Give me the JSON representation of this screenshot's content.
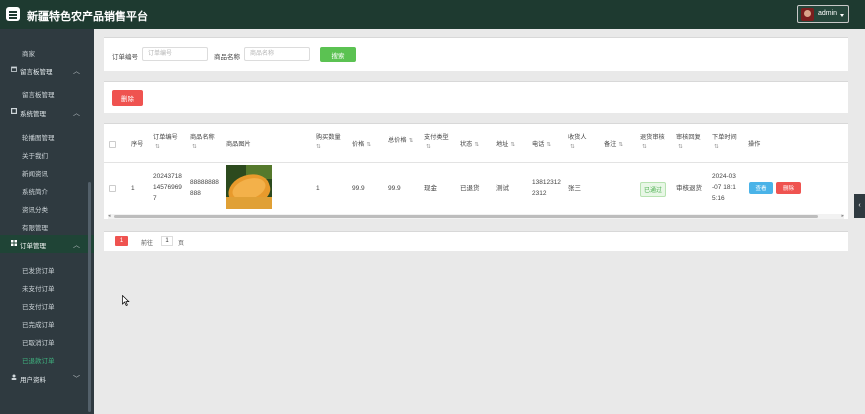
{
  "header": {
    "title": "新疆特色农产品销售平台",
    "user": "admin"
  },
  "sidebar": {
    "items": [
      {
        "label": "商家",
        "type": "sub"
      },
      {
        "label": "留言板管理",
        "type": "group",
        "icon": "calendar-icon"
      },
      {
        "label": "留言板管理",
        "type": "sub"
      },
      {
        "label": "系统管理",
        "type": "group",
        "icon": "grid-icon"
      },
      {
        "label": "轮播图管理",
        "type": "sub"
      },
      {
        "label": "关于我们",
        "type": "sub"
      },
      {
        "label": "新闻资讯",
        "type": "sub"
      },
      {
        "label": "系统简介",
        "type": "sub"
      },
      {
        "label": "资讯分类",
        "type": "sub"
      },
      {
        "label": "有限管理",
        "type": "sub"
      },
      {
        "label": "订单管理",
        "type": "group-active",
        "icon": "apps-icon"
      },
      {
        "label": "已发货订单",
        "type": "sub"
      },
      {
        "label": "未支付订单",
        "type": "sub"
      },
      {
        "label": "已支付订单",
        "type": "sub"
      },
      {
        "label": "已完成订单",
        "type": "sub"
      },
      {
        "label": "已取消订单",
        "type": "sub"
      },
      {
        "label": "已退款订单",
        "type": "sub-current"
      },
      {
        "label": "用户资料",
        "type": "group",
        "icon": "user-icon"
      }
    ]
  },
  "search": {
    "order_label": "订单编号",
    "order_placeholder": "订单编号",
    "product_label": "商品名称",
    "product_placeholder": "商品名称",
    "button": "搜索"
  },
  "actions": {
    "delete": "删除"
  },
  "table": {
    "columns": [
      "序号",
      "订单编号",
      "商品名称",
      "商品图片",
      "购买数量",
      "价格",
      "总价格",
      "支付类型",
      "状态",
      "地址",
      "电话",
      "收货人",
      "备注",
      "退货审核",
      "审核回复",
      "下单时间",
      "操作"
    ],
    "row": {
      "index": "1",
      "order_no": "20243718145769 7",
      "order_no_lines": [
        "20243718",
        "14576969",
        "7"
      ],
      "product_lines": [
        "88888888",
        "888"
      ],
      "image_icon": "melon-image",
      "qty": "1",
      "price": "99.9",
      "total": "99.9",
      "pay_type": "现金",
      "status": "已退货",
      "address": "测试",
      "phone_lines": [
        "13812312",
        "2312"
      ],
      "receiver": "张三",
      "note": "",
      "audit": "已通过",
      "reply": "审核退货",
      "time_lines": [
        "2024-03",
        "-07 18:1",
        "5:16"
      ],
      "view": "查看",
      "delete": "删除"
    }
  },
  "pagination": {
    "current": "1",
    "goto": "前往",
    "page_value": "1",
    "unit": "页"
  },
  "colors": {
    "topbar": "#1e3a30",
    "sidebar": "#2f3a40",
    "accent_green": "#5bc252",
    "danger": "#ef5350",
    "info": "#4ab3e8"
  }
}
